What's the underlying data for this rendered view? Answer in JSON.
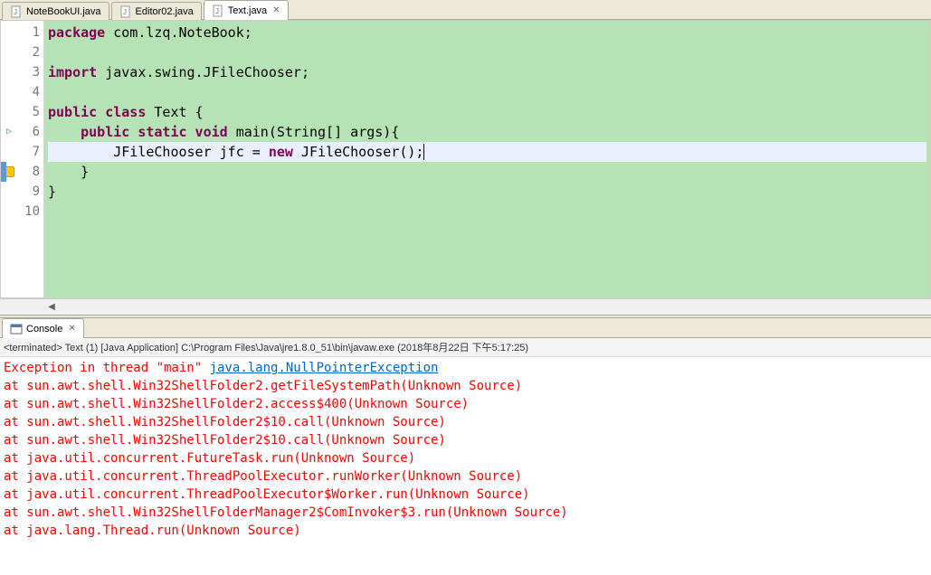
{
  "tabs": [
    {
      "label": "NoteBookUI.java",
      "active": false
    },
    {
      "label": "Editor02.java",
      "active": false
    },
    {
      "label": "Text.java",
      "active": true
    }
  ],
  "code": {
    "lines": [
      {
        "n": "1",
        "tokens": [
          {
            "t": "package",
            "c": "kw"
          },
          {
            "t": " com.lzq.NoteBook;",
            "c": ""
          }
        ]
      },
      {
        "n": "2",
        "tokens": []
      },
      {
        "n": "3",
        "tokens": [
          {
            "t": "import",
            "c": "kw"
          },
          {
            "t": " javax.swing.JFileChooser;",
            "c": ""
          }
        ]
      },
      {
        "n": "4",
        "tokens": []
      },
      {
        "n": "5",
        "tokens": [
          {
            "t": "public class",
            "c": "kw"
          },
          {
            "t": " Text {",
            "c": ""
          }
        ]
      },
      {
        "n": "6",
        "marker": "arrow",
        "hl": false,
        "tokens": [
          {
            "t": "    ",
            "c": ""
          },
          {
            "t": "public static void",
            "c": "kw"
          },
          {
            "t": " main(String[] args){",
            "c": ""
          }
        ]
      },
      {
        "n": "7",
        "marker": "warn",
        "hl": true,
        "tokens": [
          {
            "t": "        JFileChooser jfc = ",
            "c": ""
          },
          {
            "t": "new",
            "c": "kw"
          },
          {
            "t": " JFileChooser();",
            "c": ""
          }
        ],
        "cursor": true
      },
      {
        "n": "8",
        "marker": "blue",
        "tokens": [
          {
            "t": "    }",
            "c": ""
          }
        ]
      },
      {
        "n": "9",
        "tokens": [
          {
            "t": "}",
            "c": ""
          }
        ]
      },
      {
        "n": "10",
        "tokens": []
      }
    ]
  },
  "console": {
    "tab_label": "Console",
    "status": "<terminated> Text (1) [Java Application] C:\\Program Files\\Java\\jre1.8.0_51\\bin\\javaw.exe (2018年8月22日 下午5:17:25)",
    "exception_prefix": "Exception in thread \"main\" ",
    "exception_link": "java.lang.NullPointerException",
    "trace": [
      "\tat sun.awt.shell.Win32ShellFolder2.getFileSystemPath(Unknown Source)",
      "\tat sun.awt.shell.Win32ShellFolder2.access$400(Unknown Source)",
      "\tat sun.awt.shell.Win32ShellFolder2$10.call(Unknown Source)",
      "\tat sun.awt.shell.Win32ShellFolder2$10.call(Unknown Source)",
      "\tat java.util.concurrent.FutureTask.run(Unknown Source)",
      "\tat java.util.concurrent.ThreadPoolExecutor.runWorker(Unknown Source)",
      "\tat java.util.concurrent.ThreadPoolExecutor$Worker.run(Unknown Source)",
      "\tat sun.awt.shell.Win32ShellFolderManager2$ComInvoker$3.run(Unknown Source)",
      "\tat java.lang.Thread.run(Unknown Source)"
    ]
  }
}
